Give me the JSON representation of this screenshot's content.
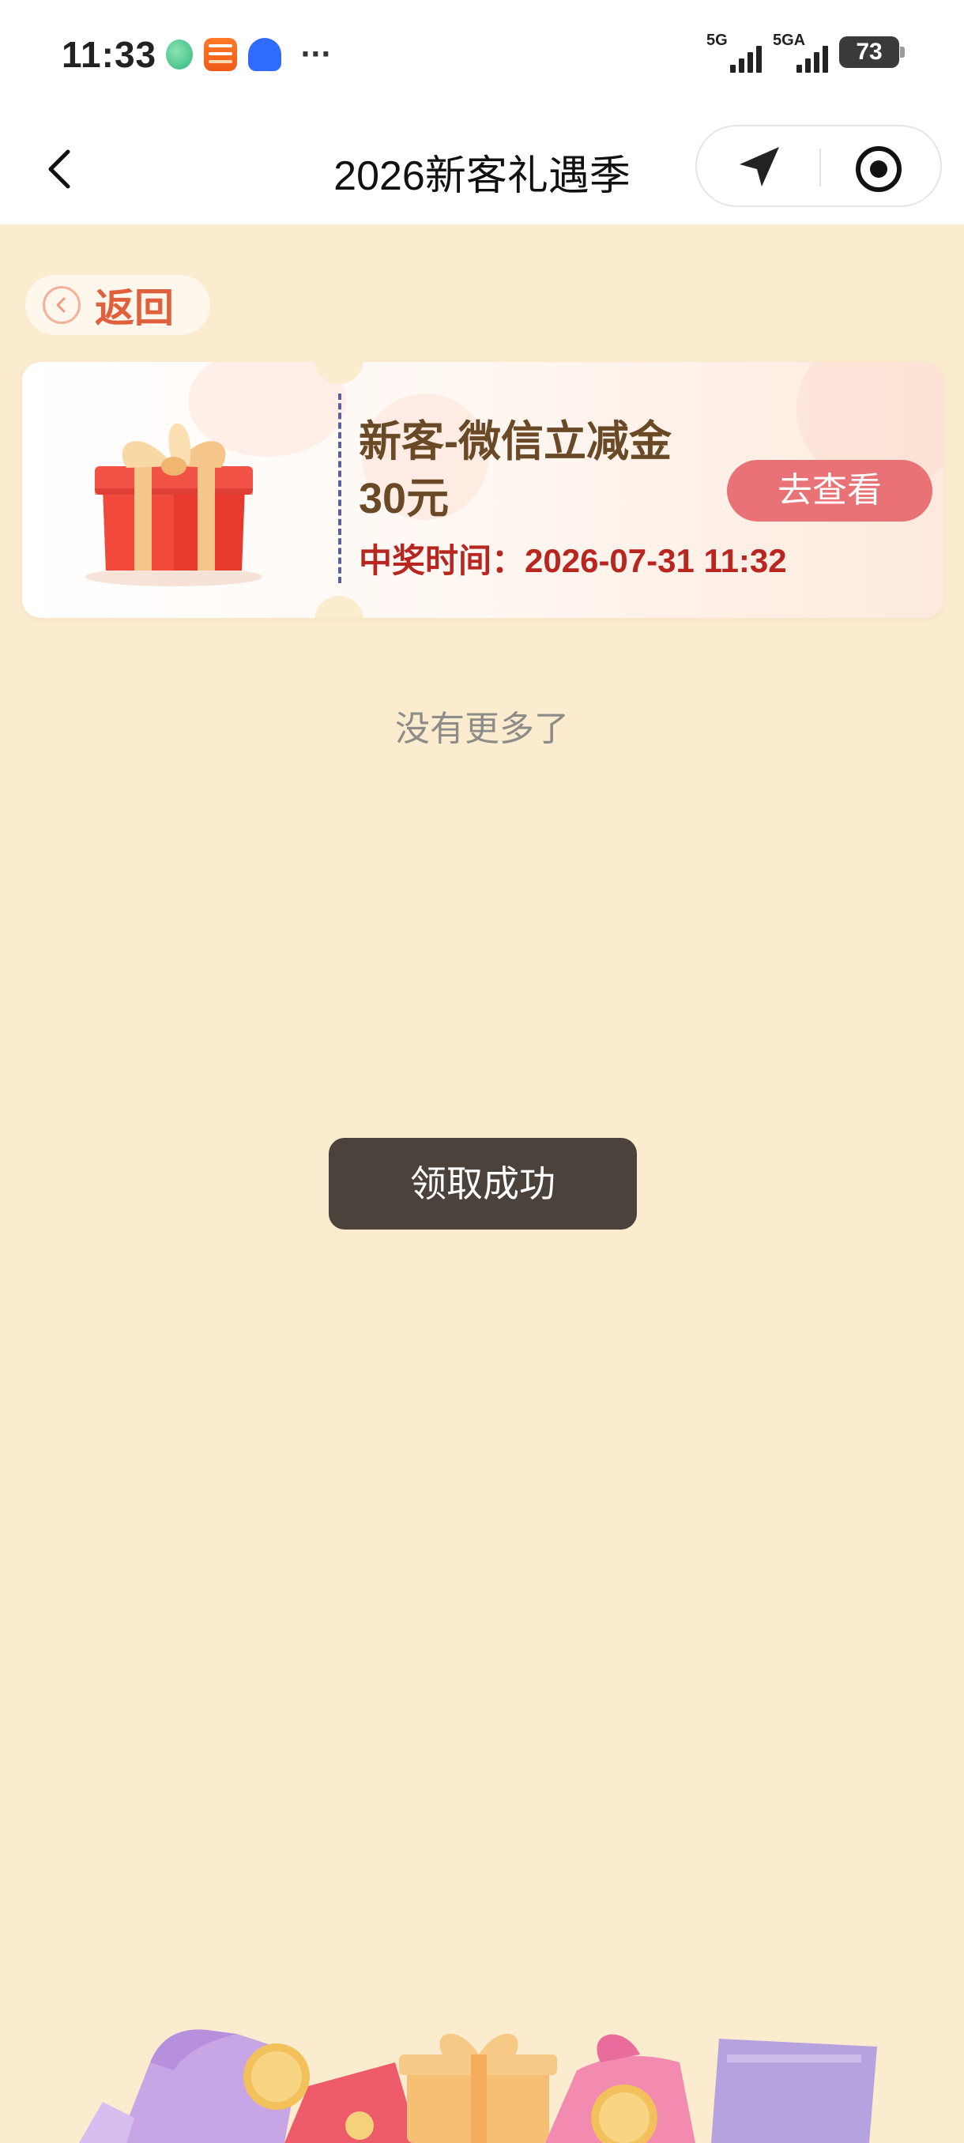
{
  "status_bar": {
    "time": "11:33",
    "dots": "···",
    "signal_1_label": "5G",
    "signal_2_label": "5GA",
    "battery": "73",
    "app_icons": [
      "leaf-app-icon",
      "taobao-app-icon",
      "baidu-app-icon"
    ]
  },
  "nav": {
    "title": "2026新客礼遇季"
  },
  "back_button": {
    "label": "返回"
  },
  "prize_card": {
    "name": "新客-微信立减金",
    "amount": "30元",
    "time_label": "中奖时间：",
    "time_value": "2026-07-31 11:32",
    "view_label": "去查看"
  },
  "list_end_text": "没有更多了",
  "toast": {
    "message": "领取成功"
  },
  "colors": {
    "page_bg": "#fbecd0",
    "accent_red": "#b8261f",
    "button_pink": "#e87275",
    "title_brown": "#6a4a26",
    "toast_bg": "#4a423b"
  }
}
